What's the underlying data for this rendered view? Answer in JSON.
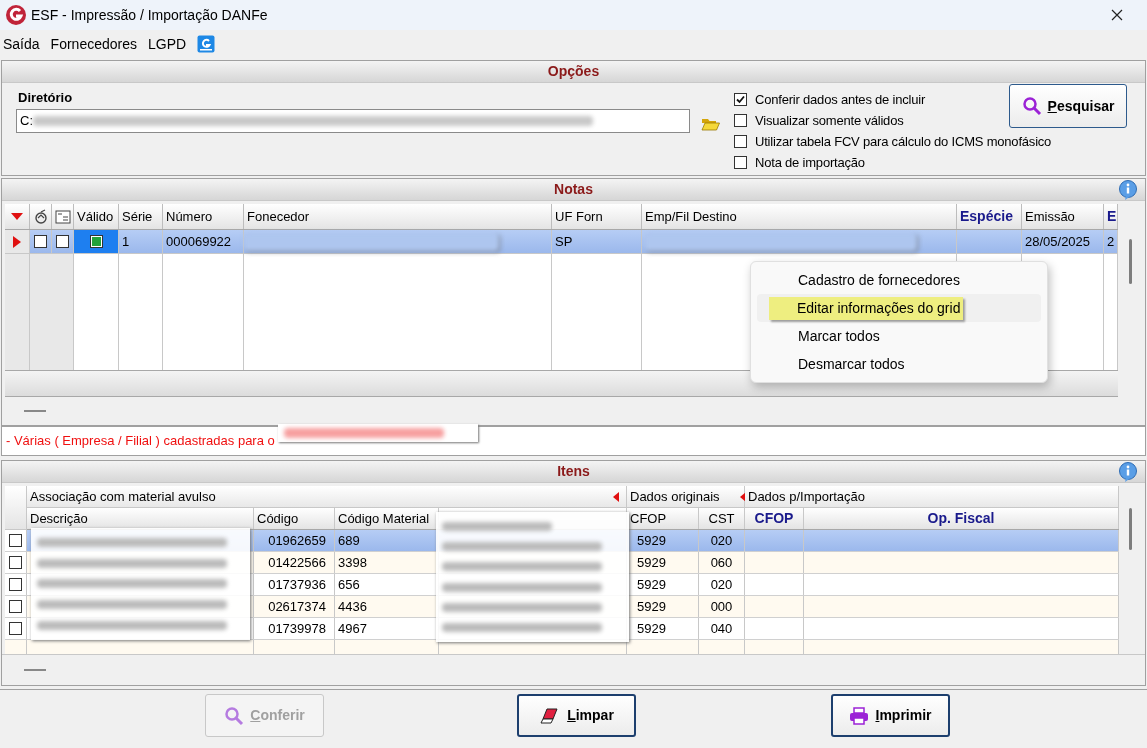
{
  "window": {
    "title": "ESF - Impressão / Importação DANFe"
  },
  "menu": [
    "Saída",
    "Fornecedores",
    "LGPD"
  ],
  "options": {
    "title": "Opções",
    "directory_label": "Diretório",
    "directory_value": "C:",
    "checkboxes": [
      {
        "label": "Conferir dados antes de incluir",
        "checked": true
      },
      {
        "label": "Visualizar somente válidos",
        "checked": false
      },
      {
        "label": "Utilizar tabela FCV para cálculo do ICMS monofásico",
        "checked": false
      },
      {
        "label": "Nota de importação",
        "checked": false
      }
    ],
    "search_button": "Pesquisar"
  },
  "notas": {
    "title": "Notas",
    "columns": [
      {
        "label": "Válido",
        "emphasis": false
      },
      {
        "label": "Série",
        "emphasis": false
      },
      {
        "label": "Número",
        "emphasis": false
      },
      {
        "label": "Fonecedor",
        "emphasis": false
      },
      {
        "label": "UF Forn",
        "emphasis": false
      },
      {
        "label": "Emp/Fil Destino",
        "emphasis": false
      },
      {
        "label": "Espécie",
        "emphasis": true
      },
      {
        "label": "Emissão",
        "emphasis": false
      },
      {
        "label": "E",
        "emphasis": true
      }
    ],
    "rows": [
      {
        "selected": true,
        "print": false,
        "mark": false,
        "valid": true,
        "serie": "1",
        "numero": "000069922",
        "uf": "SP",
        "especie": "",
        "emissao": "28/05/2025",
        "column_e": "2"
      }
    ],
    "message": "- Várias ( Empresa / Filial ) cadastradas para o"
  },
  "context_menu": [
    {
      "label": "Cadastro de fornecedores",
      "selected": false
    },
    {
      "label": "Editar informações do grid",
      "selected": true
    },
    {
      "label": "Marcar todos",
      "selected": false
    },
    {
      "label": "Desmarcar todos",
      "selected": false
    }
  ],
  "itens": {
    "title": "Itens",
    "groups": [
      {
        "label": "Associação com material avulso",
        "collapsible": true
      },
      {
        "label": "Dados originais",
        "collapsible": true
      },
      {
        "label": "Dados p/Importação",
        "collapsible": false
      }
    ],
    "columns": [
      {
        "label": "Descrição",
        "emphasis": false
      },
      {
        "label": "Código",
        "emphasis": false
      },
      {
        "label": "Código Material",
        "emphasis": false
      },
      {
        "label": "CFOP",
        "emphasis": false
      },
      {
        "label": "CST",
        "emphasis": false
      },
      {
        "label": "CFOP",
        "emphasis": true
      },
      {
        "label": "Op. Fiscal",
        "emphasis": true
      }
    ],
    "rows": [
      {
        "selected": true,
        "checked": false,
        "codigo": "01962659",
        "codigo_material": "689",
        "cfop": "5929",
        "cst": "020"
      },
      {
        "selected": false,
        "checked": false,
        "codigo": "01422566",
        "codigo_material": "3398",
        "cfop": "5929",
        "cst": "060"
      },
      {
        "selected": false,
        "checked": false,
        "codigo": "01737936",
        "codigo_material": "656",
        "cfop": "5929",
        "cst": "020"
      },
      {
        "selected": false,
        "checked": false,
        "codigo": "02617374",
        "codigo_material": "4436",
        "cfop": "5929",
        "cst": "000"
      },
      {
        "selected": false,
        "checked": false,
        "codigo": "01739978",
        "codigo_material": "4967",
        "cfop": "5929",
        "cst": "040"
      }
    ]
  },
  "buttons": [
    {
      "label": "Conferir",
      "kind": "search",
      "disabled": true
    },
    {
      "label": "Limpar",
      "kind": "eraser",
      "disabled": false
    },
    {
      "label": "Imprimir",
      "kind": "printer",
      "disabled": false
    }
  ]
}
